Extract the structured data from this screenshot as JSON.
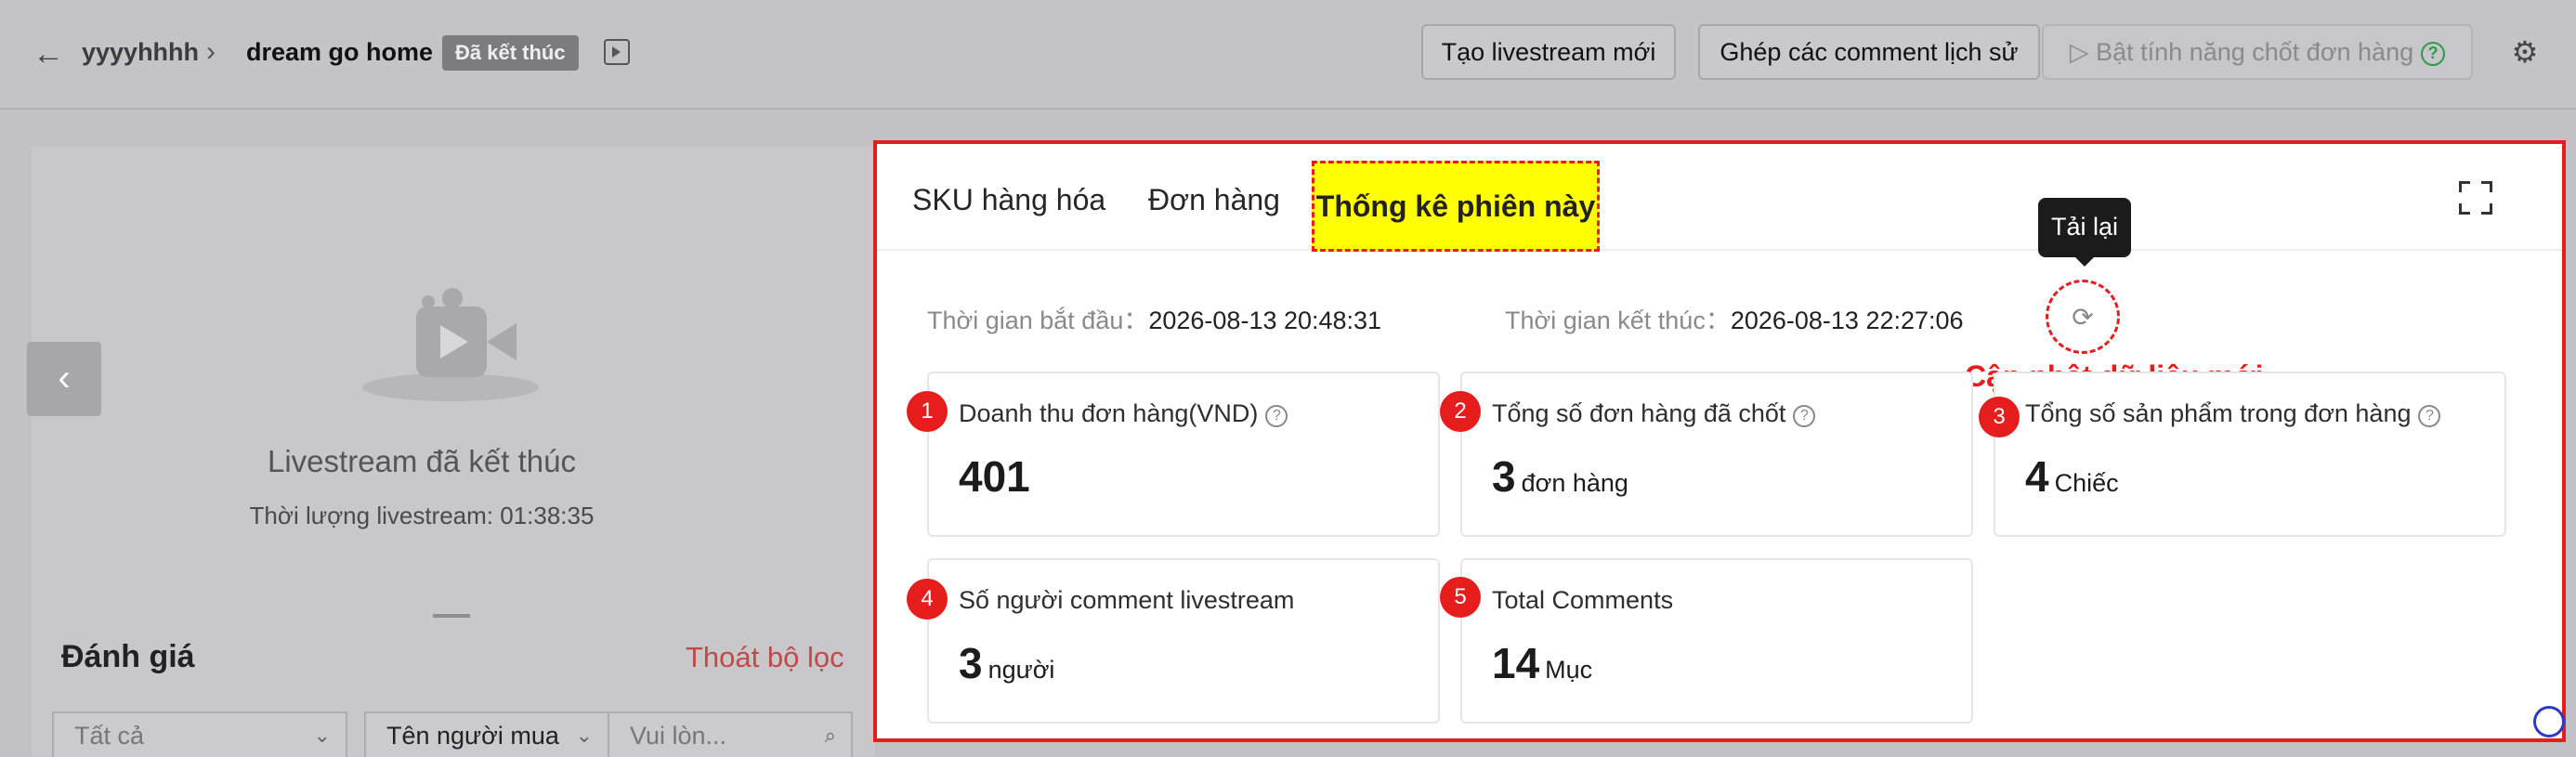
{
  "header": {
    "breadcrumb_parent": "yyyyhhhh",
    "breadcrumb_current": "dream go home",
    "status_badge": "Đã kết thúc",
    "btn_new_livestream": "Tạo livestream mới",
    "btn_merge_comments": "Ghép các comment lịch sử",
    "btn_enable_close_order": "Bật tính năng chốt đơn hàng"
  },
  "left_panel": {
    "ended_text": "Livestream đã kết thúc",
    "duration_text": "Thời lượng livestream: 01:38:35",
    "review_title": "Đánh giá",
    "exit_filter": "Thoát bộ lọc",
    "filter_all": "Tất cả",
    "filter_buyer": "Tên người mua",
    "search_placeholder": "Vui lòn..."
  },
  "tabs": {
    "sku": "SKU hàng hóa",
    "orders": "Đơn hàng",
    "stats": "Thống kê phiên này"
  },
  "session": {
    "start_label": "Thời gian bắt đầu：",
    "start_value": "2026-08-13 20:48:31",
    "end_label": "Thời gian kết thúc：",
    "end_value": "2026-08-13 22:27:06",
    "reload_tooltip": "Tải lại",
    "update_note": "Cập nhật dữ liệu mới"
  },
  "cards": [
    {
      "number": "1",
      "title": "Doanh thu đơn hàng(VND)",
      "value": "401",
      "unit": ""
    },
    {
      "number": "2",
      "title": "Tổng số đơn hàng đã chốt",
      "value": "3",
      "unit": "đơn hàng"
    },
    {
      "number": "3",
      "title": "Tổng số sản phẩm trong đơn hàng",
      "value": "4",
      "unit": "Chiếc"
    },
    {
      "number": "4",
      "title": "Số người comment livestream",
      "value": "3",
      "unit": "người"
    },
    {
      "number": "5",
      "title": "Total Comments",
      "value": "14",
      "unit": "Mục"
    }
  ],
  "icons": {
    "back": "arrow-left-icon",
    "cast": "video-cast-icon",
    "settings": "gear-icon",
    "expand": "fullscreen-icon",
    "reload": "refresh-icon",
    "help": "question-circle-icon"
  },
  "colors": {
    "highlight_red": "#e51d1d",
    "highlight_yellow": "#ffff00",
    "help_green": "#2e9a4d"
  }
}
